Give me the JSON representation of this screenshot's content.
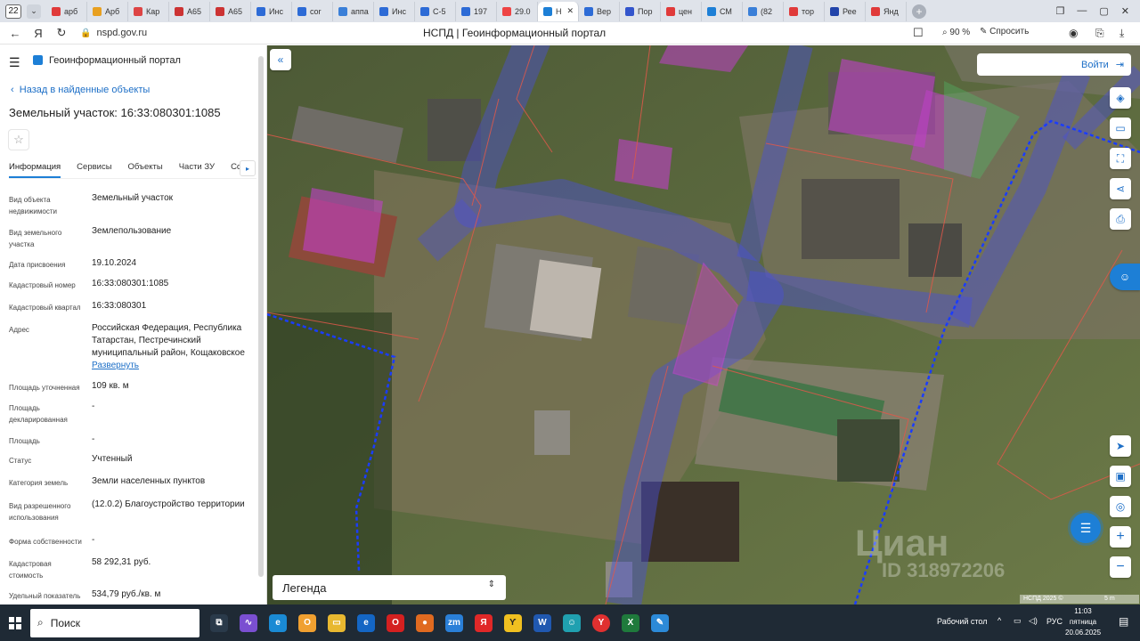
{
  "browser": {
    "tab_count": "22",
    "tabs": [
      "арб",
      "Арб",
      "Кар",
      "А65",
      "А65",
      "Инс",
      "cor",
      "аппа",
      "Инс",
      "С-5",
      "197",
      "29.0",
      "Н",
      "Вер",
      "Пор",
      "цен",
      "СМ",
      "(82",
      "тор",
      "Рее",
      "Янд"
    ],
    "active_tab_index": 12,
    "url": "nspd.gov.ru",
    "page_title": "НСПД | Геоинформационный портал",
    "zoom": "90 %",
    "ask_label": "Спросить"
  },
  "panel": {
    "portal_name": "Геоинформационный портал",
    "back_link": "Назад в найденные объекты",
    "title": "Земельный участок: 16:33:080301:1085",
    "tabs": [
      "Информация",
      "Сервисы",
      "Объекты",
      "Части ЗУ",
      "Сост"
    ],
    "fields": [
      {
        "k": "Вид объекта недвижимости",
        "v": "Земельный участок"
      },
      {
        "k": "Вид земельного участка",
        "v": "Землепользование"
      },
      {
        "k": "Дата присвоения",
        "v": "19.10.2024"
      },
      {
        "k": "Кадастровый номер",
        "v": "16:33:080301:1085"
      },
      {
        "k": "Кадастровый квартал",
        "v": "16:33:080301"
      },
      {
        "k": "Адрес",
        "v": "Российская Федерация, Республика Татарстан, Пестречинский муниципальный район, Кощаковское",
        "more": "Развернуть"
      },
      {
        "k": "Площадь уточненная",
        "v": "109 кв. м"
      },
      {
        "k": "Площадь декларированная",
        "v": "-"
      },
      {
        "k": "Площадь",
        "v": "-"
      },
      {
        "k": "Статус",
        "v": "Учтенный"
      },
      {
        "k": "Категория земель",
        "v": "Земли населенных пунктов"
      },
      {
        "k": "Вид разрешенного использования",
        "v": "(12.0.2) Благоустройство территории"
      },
      {
        "k": "Форма собственности",
        "v": "-"
      },
      {
        "k": "Кадастровая стоимость",
        "v": "58 292,31 руб."
      },
      {
        "k": "Удельный показатель",
        "v": "534,79 руб./кв. м"
      }
    ]
  },
  "map": {
    "login_label": "Войти",
    "legend_label": "Легенда",
    "scale_label": "5 m",
    "scale_credit": "НСПД 2025 ©",
    "watermark": "Циан",
    "watermark_id": "ID 318972206"
  },
  "taskbar": {
    "search_placeholder": "Поиск",
    "desktop_label": "Рабочий стол",
    "lang": "РУС",
    "time": "11:03",
    "weekday": "пятница",
    "date": "20.06.2025"
  },
  "colors": {
    "accent": "#1d7fd6",
    "parcel_fill": "#c040c8",
    "road_overlay": "#4a4fd8",
    "boundary_red": "#e0584a",
    "dashed_blue": "#1a3cff"
  }
}
